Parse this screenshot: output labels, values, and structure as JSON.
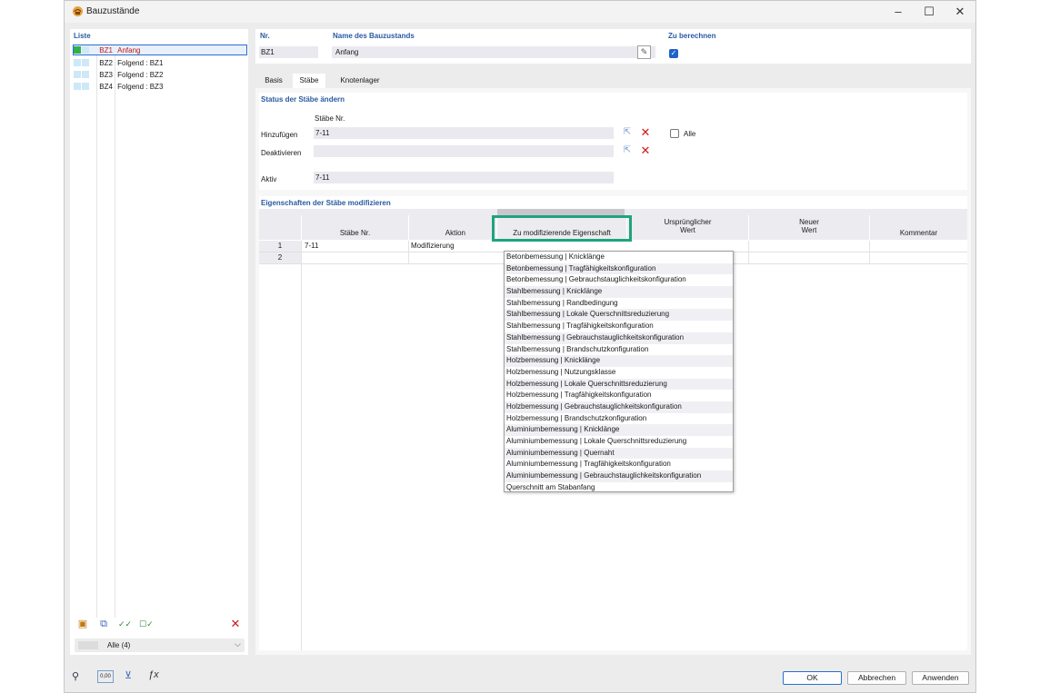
{
  "window": {
    "title": "Bauzustände",
    "controls": [
      "–",
      "☐",
      "✕"
    ]
  },
  "list": {
    "header": "Liste",
    "items": [
      {
        "id": "BZ1",
        "name": "Anfang",
        "color": "#2fb24a",
        "selected": true
      },
      {
        "id": "BZ2",
        "name": "Folgend : BZ1",
        "color": "#cde8f6",
        "selected": false
      },
      {
        "id": "BZ3",
        "name": "Folgend : BZ2",
        "color": "#cde8f6",
        "selected": false
      },
      {
        "id": "BZ4",
        "name": "Folgend : BZ3",
        "color": "#cde8f6",
        "selected": false
      }
    ],
    "filter": "Alle (4)"
  },
  "header_fields": {
    "nr_label": "Nr.",
    "nr_value": "BZ1",
    "name_label": "Name des Bauzustands",
    "name_value": "Anfang",
    "calc_label": "Zu berechnen",
    "calc_checked": true
  },
  "tabs": [
    {
      "label": "Basis",
      "active": false
    },
    {
      "label": "Stäbe",
      "active": true
    },
    {
      "label": "Knotenlager",
      "active": false
    }
  ],
  "status_section": {
    "title": "Status der Stäbe ändern",
    "column_label": "Stäbe Nr.",
    "add_label": "Hinzufügen",
    "add_value": "7-11",
    "deactivate_label": "Deaktivieren",
    "deactivate_value": "",
    "all_label": "Alle",
    "active_label": "Aktiv",
    "active_value": "7-11"
  },
  "modify_section": {
    "title": "Eigenschaften der Stäbe modifizieren",
    "columns": [
      "Stäbe Nr.",
      "Aktion",
      "Zu modifizierende Eigenschaft",
      "Ursprünglicher\nWert",
      "Neuer\nWert",
      "Kommentar"
    ],
    "rows": [
      {
        "num": "1",
        "members": "7-11",
        "action": "Modifizierung"
      },
      {
        "num": "2",
        "members": "",
        "action": ""
      }
    ]
  },
  "dropdown_options": [
    "Betonbemessung | Knicklänge",
    "Betonbemessung | Tragfähigkeitskonfiguration",
    "Betonbemessung | Gebrauchstauglichkeitskonfiguration",
    "Stahlbemessung | Knicklänge",
    "Stahlbemessung | Randbedingung",
    "Stahlbemessung | Lokale Querschnittsreduzierung",
    "Stahlbemessung | Tragfähigkeitskonfiguration",
    "Stahlbemessung | Gebrauchstauglichkeitskonfiguration",
    "Stahlbemessung | Brandschutzkonfiguration",
    "Holzbemessung | Knicklänge",
    "Holzbemessung | Nutzungsklasse",
    "Holzbemessung | Lokale Querschnittsreduzierung",
    "Holzbemessung | Tragfähigkeitskonfiguration",
    "Holzbemessung | Gebrauchstauglichkeitskonfiguration",
    "Holzbemessung | Brandschutzkonfiguration",
    "Aluminiumbemessung | Knicklänge",
    "Aluminiumbemessung | Lokale Querschnittsreduzierung",
    "Aluminiumbemessung | Quernaht",
    "Aluminiumbemessung | Tragfähigkeitskonfiguration",
    "Aluminiumbemessung | Gebrauchstauglichkeitskonfiguration",
    "Querschnitt am Stabanfang"
  ],
  "footer": {
    "ok": "OK",
    "cancel": "Abbrechen",
    "apply": "Anwenden",
    "decimals_icon_text": "0,00"
  },
  "colors": {
    "accent": "#2a5aa0",
    "highlight_box": "#1fa37f",
    "delete_red": "#d11a1a"
  }
}
